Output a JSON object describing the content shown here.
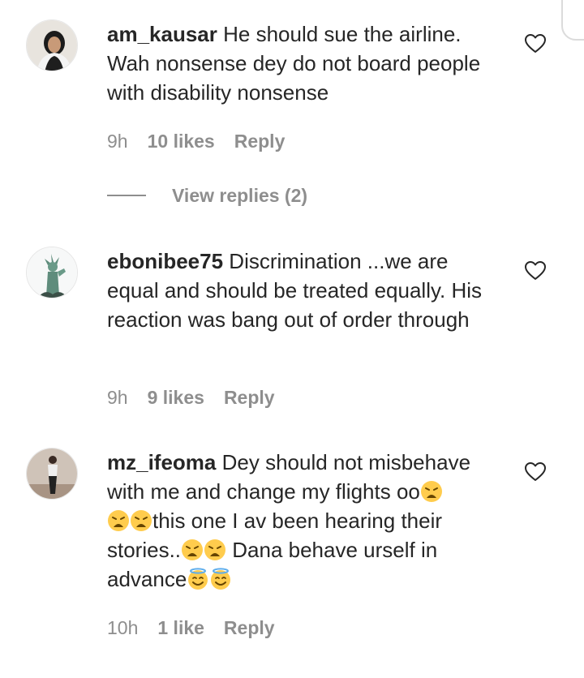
{
  "comments": [
    {
      "username": "am_kausar",
      "text": "He should sue the airline. Wah nonsense dey do not board people with disability nonsense",
      "time": "9h",
      "likes": "10 likes",
      "reply": "Reply",
      "view_replies": "View replies (2)"
    },
    {
      "username": "ebonibee75",
      "text": "Discrimination ...we are equal and should be treated equally. His reaction was bang out of order through",
      "time": "9h",
      "likes": "9 likes",
      "reply": "Reply"
    },
    {
      "username": "mz_ifeoma",
      "text_1": "Dey should not misbehave with me and change my flights oo",
      "text_2": "this one I av been hearing their stories..",
      "text_3": " Dana behave urself in advance",
      "time": "10h",
      "likes": "1 like",
      "reply": "Reply"
    }
  ],
  "icons": {
    "like": "heart-outline-icon",
    "emoji_weary": "weary-face-emoji",
    "emoji_halo": "smiling-face-with-halo-emoji"
  },
  "colors": {
    "text": "#262626",
    "secondary": "#8e8e8e",
    "border": "#dbdbdb"
  }
}
